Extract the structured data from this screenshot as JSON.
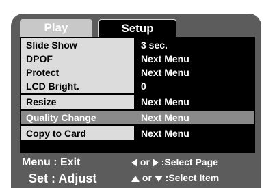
{
  "tabs": {
    "play": "Play",
    "setup": "Setup"
  },
  "rows": [
    {
      "label": "Slide Show",
      "value": "3 sec."
    },
    {
      "label": "DPOF",
      "value": "Next Menu"
    },
    {
      "label": "Protect",
      "value": "Next Menu"
    },
    {
      "label": "LCD Bright.",
      "value": "0"
    },
    {
      "label": "Resize",
      "value": "Next Menu"
    },
    {
      "label": "Quality Change",
      "value": "Next Menu"
    },
    {
      "label": "Copy to Card",
      "value": "Next Menu"
    }
  ],
  "selected_row": "Quality Change",
  "footer": {
    "menu_exit": "Menu : Exit",
    "set_adjust": "Set : Adjust",
    "or1": " or ",
    "select_page": " :Select Page",
    "or2": " or ",
    "select_item": " :Select Item"
  },
  "icons": [
    "left-arrow-icon",
    "right-arrow-icon",
    "up-arrow-icon",
    "down-arrow-icon"
  ]
}
